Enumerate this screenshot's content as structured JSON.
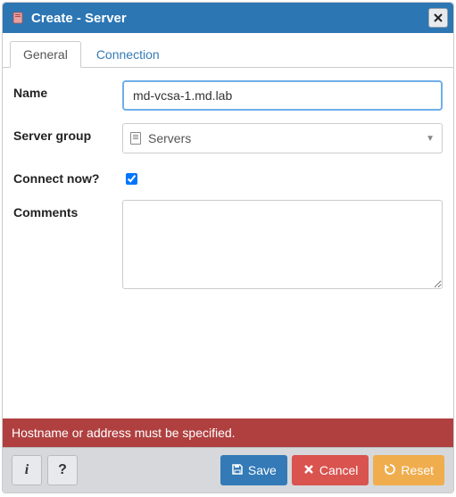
{
  "dialog": {
    "title": "Create - Server"
  },
  "tabs": {
    "general": "General",
    "connection": "Connection"
  },
  "form": {
    "name_label": "Name",
    "name_value": "md-vcsa-1.md.lab",
    "servergroup_label": "Server group",
    "servergroup_value": "Servers",
    "connectnow_label": "Connect now?",
    "connectnow_checked": true,
    "comments_label": "Comments",
    "comments_value": ""
  },
  "error": {
    "message": "Hostname or address must be specified."
  },
  "footer": {
    "info_label": "i",
    "help_label": "?",
    "save": "Save",
    "cancel": "Cancel",
    "reset": "Reset"
  }
}
